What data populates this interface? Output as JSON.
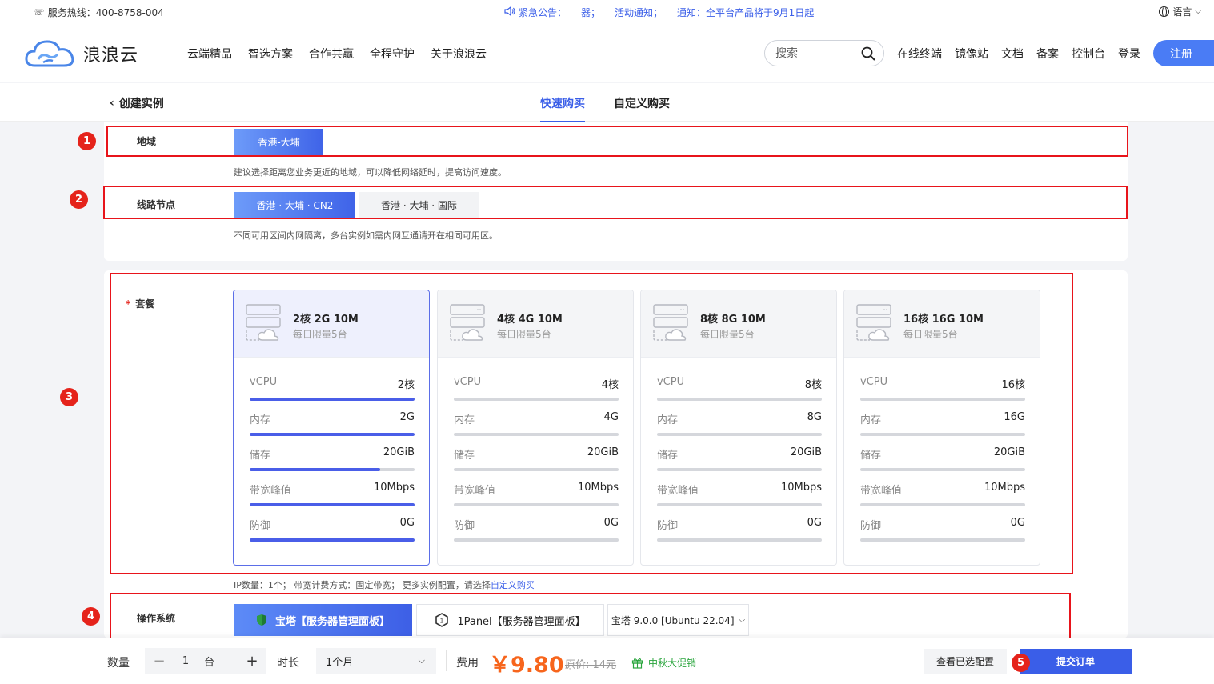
{
  "topbar": {
    "hotline": "服务热线：400-8758-004",
    "notices": [
      "紧急公告：",
      "器；",
      "活动通知；",
      "通知：全平台产品将于9月1日起"
    ],
    "language": "语言"
  },
  "nav": {
    "logo_text": "浪浪云",
    "menu": [
      "云端精品",
      "智选方案",
      "合作共赢",
      "全程守护",
      "关于浪浪云"
    ],
    "search_placeholder": "搜索",
    "right_links": [
      "在线终端",
      "镜像站",
      "文档",
      "备案",
      "控制台",
      "登录"
    ],
    "register": "注册"
  },
  "subhead": {
    "back_label": "创建实例",
    "tabs": [
      "快速购买",
      "自定义购买"
    ],
    "active_tab": "快速购买"
  },
  "region": {
    "label": "地域",
    "options": [
      "香港-大埔"
    ],
    "hint": "建议选择距离您业务更近的地域，可以降低网络延时，提高访问速度。"
  },
  "line": {
    "label": "线路节点",
    "options": [
      "香港 · 大埔 · CN2",
      "香港 · 大埔 · 国际"
    ],
    "hint": "不同可用区间内网隔离，多台实例如需内网互通请开在相同可用区。"
  },
  "plan": {
    "required_mark": "*",
    "label": "套餐",
    "cards": [
      {
        "title": "2核 2G 10M",
        "sub": "每日限量5台",
        "selected": true,
        "specs": [
          {
            "name": "vCPU",
            "value": "2核",
            "fill": 1.0
          },
          {
            "name": "内存",
            "value": "2G",
            "fill": 1.0
          },
          {
            "name": "储存",
            "value": "20GiB",
            "fill": 0.79
          },
          {
            "name": "带宽峰值",
            "value": "10Mbps",
            "fill": 1.0
          },
          {
            "name": "防御",
            "value": "0G",
            "fill": 1.0
          }
        ]
      },
      {
        "title": "4核 4G 10M",
        "sub": "每日限量5台",
        "selected": false,
        "specs": [
          {
            "name": "vCPU",
            "value": "4核",
            "fill": 0
          },
          {
            "name": "内存",
            "value": "4G",
            "fill": 0
          },
          {
            "name": "储存",
            "value": "20GiB",
            "fill": 0
          },
          {
            "name": "带宽峰值",
            "value": "10Mbps",
            "fill": 0
          },
          {
            "name": "防御",
            "value": "0G",
            "fill": 0
          }
        ]
      },
      {
        "title": "8核 8G 10M",
        "sub": "每日限量5台",
        "selected": false,
        "specs": [
          {
            "name": "vCPU",
            "value": "8核",
            "fill": 0
          },
          {
            "name": "内存",
            "value": "8G",
            "fill": 0
          },
          {
            "name": "储存",
            "value": "20GiB",
            "fill": 0
          },
          {
            "name": "带宽峰值",
            "value": "10Mbps",
            "fill": 0
          },
          {
            "name": "防御",
            "value": "0G",
            "fill": 0
          }
        ]
      },
      {
        "title": "16核 16G 10M",
        "sub": "每日限量5台",
        "selected": false,
        "specs": [
          {
            "name": "vCPU",
            "value": "16核",
            "fill": 0
          },
          {
            "name": "内存",
            "value": "16G",
            "fill": 0
          },
          {
            "name": "储存",
            "value": "20GiB",
            "fill": 0
          },
          {
            "name": "带宽峰值",
            "value": "10Mbps",
            "fill": 0
          },
          {
            "name": "防御",
            "value": "0G",
            "fill": 0
          }
        ]
      }
    ],
    "hint_prefix": "IP数量：1个；  带宽计费方式：固定带宽；  更多实例配置，请选择",
    "hint_link": "自定义购买"
  },
  "os": {
    "label": "操作系统",
    "options": [
      "宝塔【服务器管理面板】",
      "1Panel【服务器管理面板】"
    ],
    "version": "宝塔 9.0.0 [Ubuntu 22.04]"
  },
  "bottom": {
    "qty_label": "数量",
    "qty_value": "1",
    "qty_unit": "台",
    "duration_label": "时长",
    "duration_value": "1个月",
    "fee_label": "费用",
    "price": "￥9.80",
    "original_price": "原价: 14元",
    "promo": "中秋大促销",
    "view_config": "查看已选配置",
    "submit": "提交订单"
  },
  "annotations": [
    "1",
    "2",
    "3",
    "4",
    "5"
  ],
  "colors": {
    "accent": "#3a5ee8",
    "annotation_red": "#e8141b",
    "price": "#f7651c",
    "promo": "#2aa53d"
  }
}
